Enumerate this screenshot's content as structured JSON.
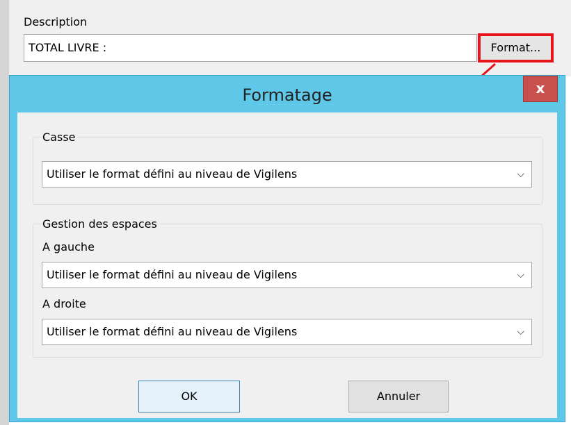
{
  "parent": {
    "description_label": "Description",
    "description_value": "TOTAL LIVRE :",
    "format_button": "Format..."
  },
  "dialog": {
    "title": "Formatage",
    "close_label": "x",
    "casse": {
      "legend": "Casse",
      "selected": "Utiliser le format défini au niveau de Vigilens"
    },
    "espaces": {
      "legend": "Gestion des espaces",
      "gauche_label": "A gauche",
      "gauche_selected": "Utiliser le format défini au niveau de Vigilens",
      "droite_label": "A droite",
      "droite_selected": "Utiliser le format défini au niveau de Vigilens"
    },
    "ok_button": "OK",
    "cancel_button": "Annuler"
  },
  "icons": {
    "dropdown": "chevron-down-icon",
    "arrow": "red-arrow-annotation"
  },
  "colors": {
    "title_bar": "#5fc8e8",
    "close_button": "#c8504d",
    "highlight": "#e8141c"
  }
}
